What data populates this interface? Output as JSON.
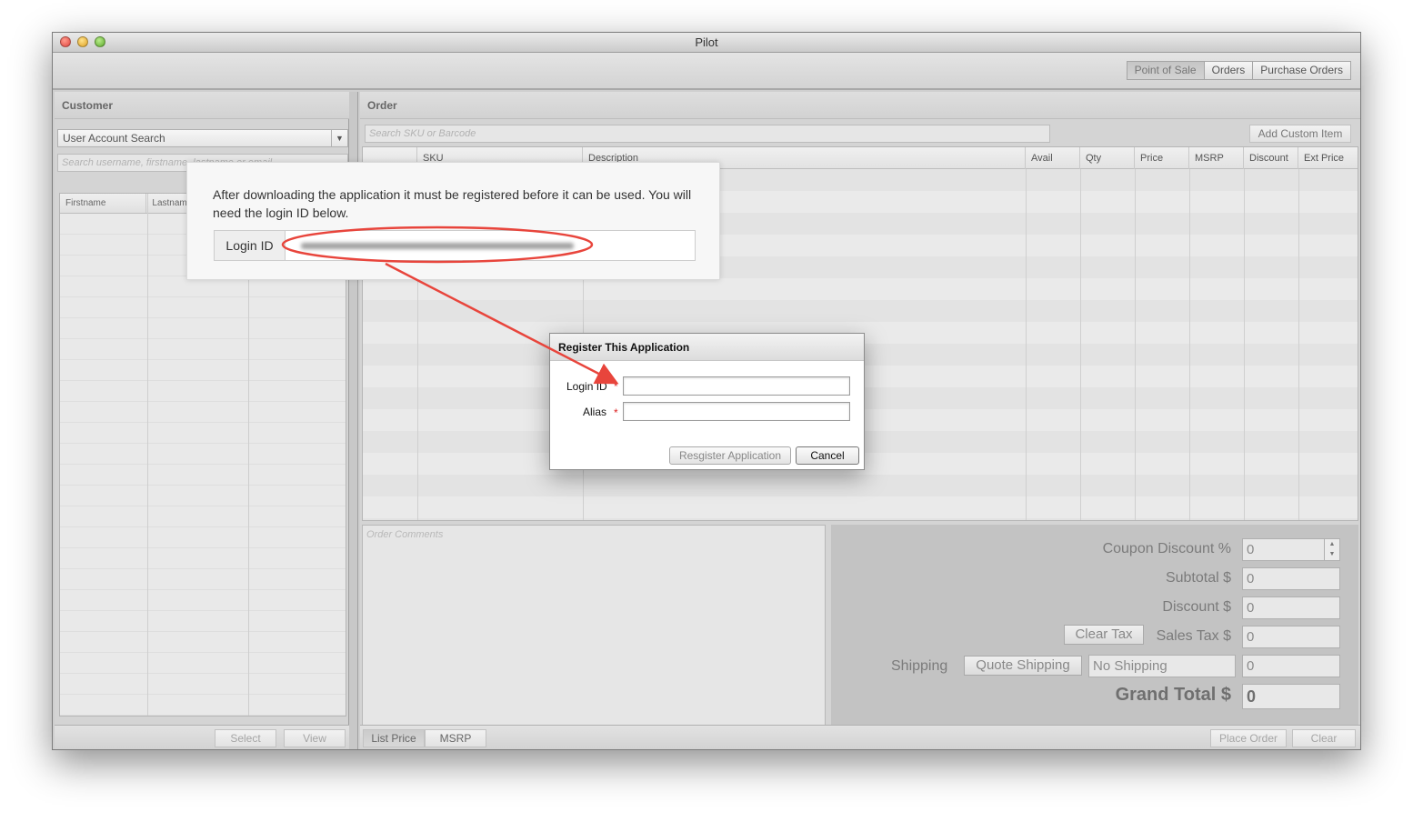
{
  "window": {
    "title": "Pilot"
  },
  "toolbar": {
    "tabs": [
      "Point of Sale",
      "Orders",
      "Purchase Orders"
    ],
    "active_tab": "Point of Sale"
  },
  "customer": {
    "heading": "Customer",
    "search_type": "User Account Search",
    "search_placeholder": "Search username, firstname, lastname or email",
    "columns": [
      "Firstname",
      "Lastname",
      ""
    ],
    "buttons": {
      "select": "Select",
      "view": "View"
    }
  },
  "order": {
    "heading": "Order",
    "search_placeholder": "Search SKU or Barcode",
    "add_custom_item": "Add Custom Item",
    "columns": [
      "",
      "SKU",
      "Description",
      "Avail",
      "Qty",
      "Price",
      "MSRP",
      "Discount",
      "Ext Price"
    ],
    "comments_placeholder": "Order Comments",
    "price_toggle": [
      "List Price",
      "MSRP"
    ],
    "buttons": {
      "place_order": "Place Order",
      "clear": "Clear"
    }
  },
  "totals": {
    "coupon_discount_label": "Coupon Discount %",
    "coupon_discount_value": "0",
    "subtotal_label": "Subtotal $",
    "subtotal_value": "0",
    "discount_label": "Discount $",
    "discount_value": "0",
    "clear_tax_button": "Clear Tax",
    "sales_tax_label": "Sales Tax $",
    "sales_tax_value": "0",
    "shipping_label": "Shipping",
    "quote_shipping_button": "Quote Shipping",
    "shipping_method": "No Shipping",
    "shipping_value": "0",
    "grand_total_label": "Grand Total $",
    "grand_total_value": "0"
  },
  "callout": {
    "text": "After downloading the application it must be registered before it can be used. You will need the login ID below.",
    "login_label": "Login ID"
  },
  "dialog": {
    "title": "Register This Application",
    "login_id_label": "Login ID",
    "alias_label": "Alias",
    "required_mark": "*",
    "register_button": "Resgister Application",
    "cancel_button": "Cancel"
  },
  "colors": {
    "annotation_red": "#e8453c"
  }
}
